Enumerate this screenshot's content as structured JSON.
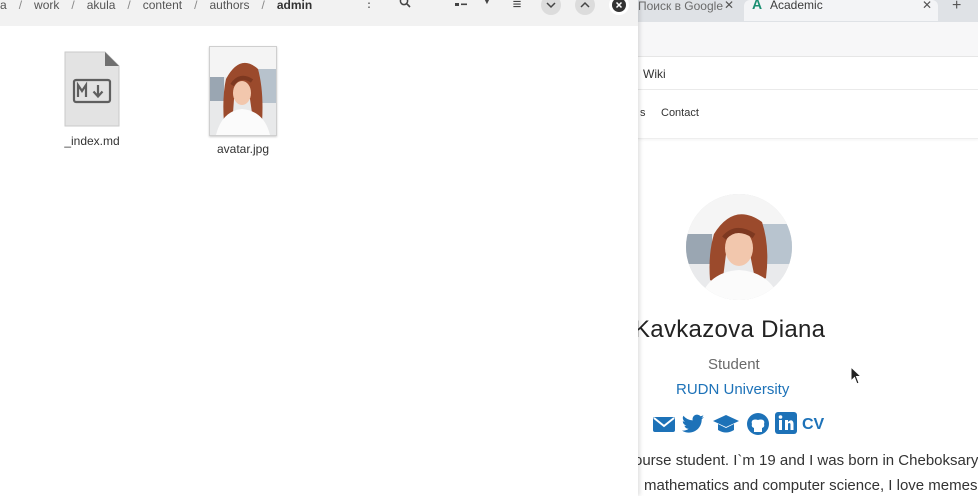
{
  "file_manager": {
    "breadcrumbs": [
      "a",
      "work",
      "akula",
      "content",
      "authors",
      "admin"
    ],
    "files": [
      {
        "name": "_index.md",
        "icon": "markdown-file-icon"
      },
      {
        "name": "avatar.jpg",
        "icon": "image-thumbnail"
      }
    ]
  },
  "browser": {
    "tabs": [
      {
        "label": "Поиск в Google"
      },
      {
        "label": "Academic",
        "active": true
      }
    ],
    "bookmark_text": "Wiki",
    "nav_fragment": "s",
    "nav_contact": "Contact",
    "profile": {
      "name": "Kavkazova Diana",
      "role": "Student",
      "organization": "RUDN University",
      "cv_label": "CV",
      "bio_line1": "ourse student. I`m 19 and I was born in Cheboksary,",
      "bio_line2": "mathematics and computer science, I love memes"
    }
  },
  "colors": {
    "link_blue": "#1d72b8",
    "academic_green": "#1a8f72"
  }
}
